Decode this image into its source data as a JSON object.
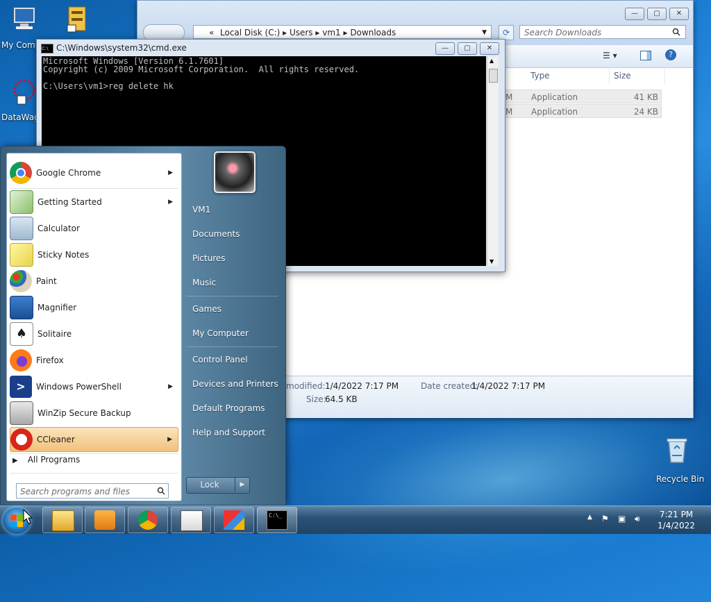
{
  "desktop": {
    "icons": [
      {
        "label": "My Comp"
      },
      {
        "label": "DataWag"
      },
      {
        "label": "Recycle Bin"
      }
    ]
  },
  "explorer": {
    "address": {
      "prefix": "«",
      "path": [
        "Local Disk (C:)",
        "Users",
        "vm1",
        "Downloads"
      ]
    },
    "search_placeholder": "Search Downloads",
    "columns": {
      "type": "Type",
      "size": "Size"
    },
    "rows": [
      {
        "name_tail": "M",
        "type": "Application",
        "size": "41 KB"
      },
      {
        "name_tail": "M",
        "type": "Application",
        "size": "24 KB"
      }
    ],
    "details": {
      "modified_label": "modified:",
      "modified_value": "1/4/2022 7:17 PM",
      "created_label": "Date created:",
      "created_value": "1/4/2022 7:17 PM",
      "size_label": "Size:",
      "size_value": "64.5 KB"
    },
    "buttons": {
      "minimize": "—",
      "maximize": "▢",
      "close": "✕"
    }
  },
  "cmd": {
    "title": "C:\\Windows\\system32\\cmd.exe",
    "icon_text": "C:\\",
    "lines": [
      "Microsoft Windows [Version 6.1.7601]",
      "Copyright (c) 2009 Microsoft Corporation.  All rights reserved.",
      "",
      "C:\\Users\\vm1>reg delete hk"
    ],
    "buttons": {
      "minimize": "—",
      "maximize": "▢",
      "close": "✕"
    }
  },
  "start_menu": {
    "programs": [
      {
        "label": "Google Chrome",
        "has_arrow": true
      },
      {
        "label": "Getting Started",
        "has_arrow": true
      },
      {
        "label": "Calculator",
        "has_arrow": false
      },
      {
        "label": "Sticky Notes",
        "has_arrow": false
      },
      {
        "label": "Paint",
        "has_arrow": false
      },
      {
        "label": "Magnifier",
        "has_arrow": false
      },
      {
        "label": "Solitaire",
        "has_arrow": false
      },
      {
        "label": "Firefox",
        "has_arrow": false
      },
      {
        "label": "Windows PowerShell",
        "has_arrow": true
      },
      {
        "label": "WinZip Secure Backup",
        "has_arrow": false
      },
      {
        "label": "CCleaner",
        "has_arrow": true
      }
    ],
    "all_programs": "All Programs",
    "search_placeholder": "Search programs and files",
    "right_items": [
      "VM1",
      "Documents",
      "Pictures",
      "Music",
      "Games",
      "My Computer",
      "Control Panel",
      "Devices and Printers",
      "Default Programs",
      "Help and Support"
    ],
    "lock_label": "Lock"
  },
  "taskbar": {
    "clock_time": "7:21 PM",
    "clock_date": "1/4/2022",
    "cmd_icon_text": "C:\\_"
  }
}
